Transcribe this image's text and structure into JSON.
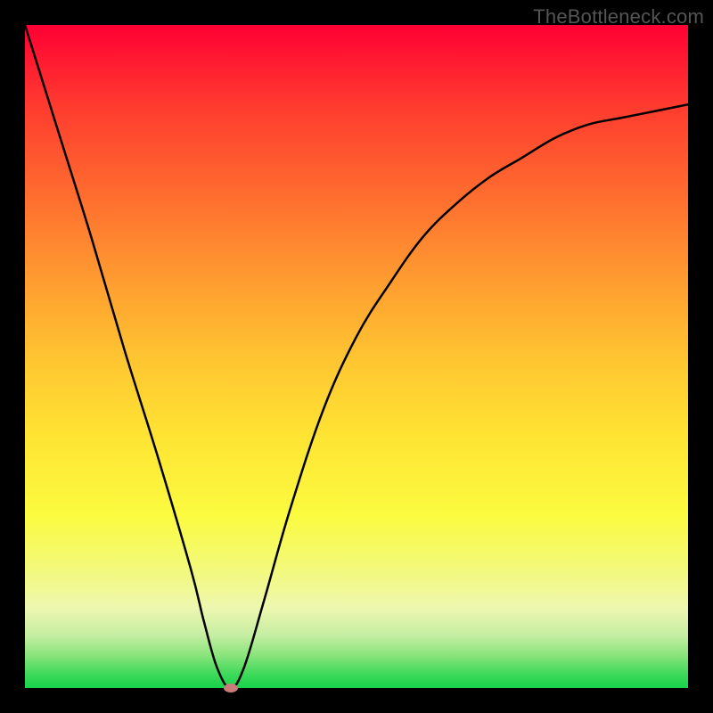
{
  "watermark": "TheBottleneck.com",
  "chart_data": {
    "type": "line",
    "title": "",
    "xlabel": "",
    "ylabel": "",
    "xlim": [
      0,
      100
    ],
    "ylim": [
      0,
      100
    ],
    "background_meaning": "vertical gradient from red (high bottleneck) to green (no bottleneck)",
    "series": [
      {
        "name": "bottleneck-curve",
        "x": [
          0,
          5,
          10,
          15,
          20,
          25,
          27,
          29,
          31,
          33,
          36,
          40,
          45,
          50,
          55,
          60,
          65,
          70,
          75,
          80,
          85,
          90,
          95,
          100
        ],
        "y": [
          100,
          84,
          68,
          51,
          35,
          18,
          10,
          3,
          0,
          3,
          13,
          27,
          42,
          53,
          61,
          68,
          73,
          77,
          80,
          83,
          85,
          86,
          87,
          88
        ]
      }
    ],
    "optimum": {
      "x": 31,
      "y": 0
    },
    "marker": {
      "x": 31,
      "y": 0,
      "color": "#c97a7a"
    }
  }
}
